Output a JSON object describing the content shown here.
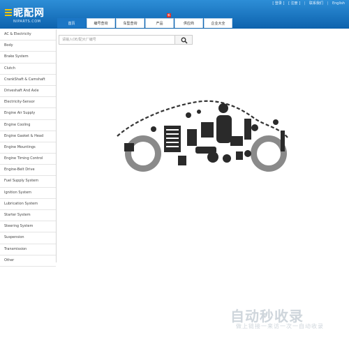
{
  "header": {
    "logo_text": "昵配网",
    "logo_sub": "NIPARTS.COM",
    "links": [
      "[ 登录 ]",
      "[ 注册 ]",
      "联系我们",
      "English"
    ]
  },
  "nav": {
    "items": [
      {
        "label": "首页",
        "active": true
      },
      {
        "label": "编号查询",
        "active": false
      },
      {
        "label": "车型查询",
        "active": false
      },
      {
        "label": "产品",
        "active": false,
        "badge": "新"
      },
      {
        "label": "供应商",
        "active": false
      },
      {
        "label": "企业大全",
        "active": false
      }
    ]
  },
  "sidebar": {
    "items": [
      "AC & Electricity",
      "Body",
      "Brake System",
      "Clutch",
      "CrankShaft & Camshaft",
      "Driveshaft And Axle",
      "Electricity-Sensor",
      "Engine Air Supply",
      "Engine Cooling",
      "Engine Gasket & Head",
      "Engine Mountings",
      "Engine Timing Control",
      "Engine-Belt Drive",
      "Fuel Supply System",
      "Ignition System",
      "Lubrication System",
      "Starter System",
      "Steering System",
      "Suspension",
      "Transmission",
      "Other"
    ]
  },
  "search": {
    "placeholder": "请输入OE/配大厂编号"
  },
  "watermark": {
    "main": "自动秒收录",
    "sub": "做上链接一来访一次一自动收录"
  },
  "colors": {
    "header": "#1b76c5",
    "accent": "#f2c400",
    "badge": "#e0281d"
  }
}
